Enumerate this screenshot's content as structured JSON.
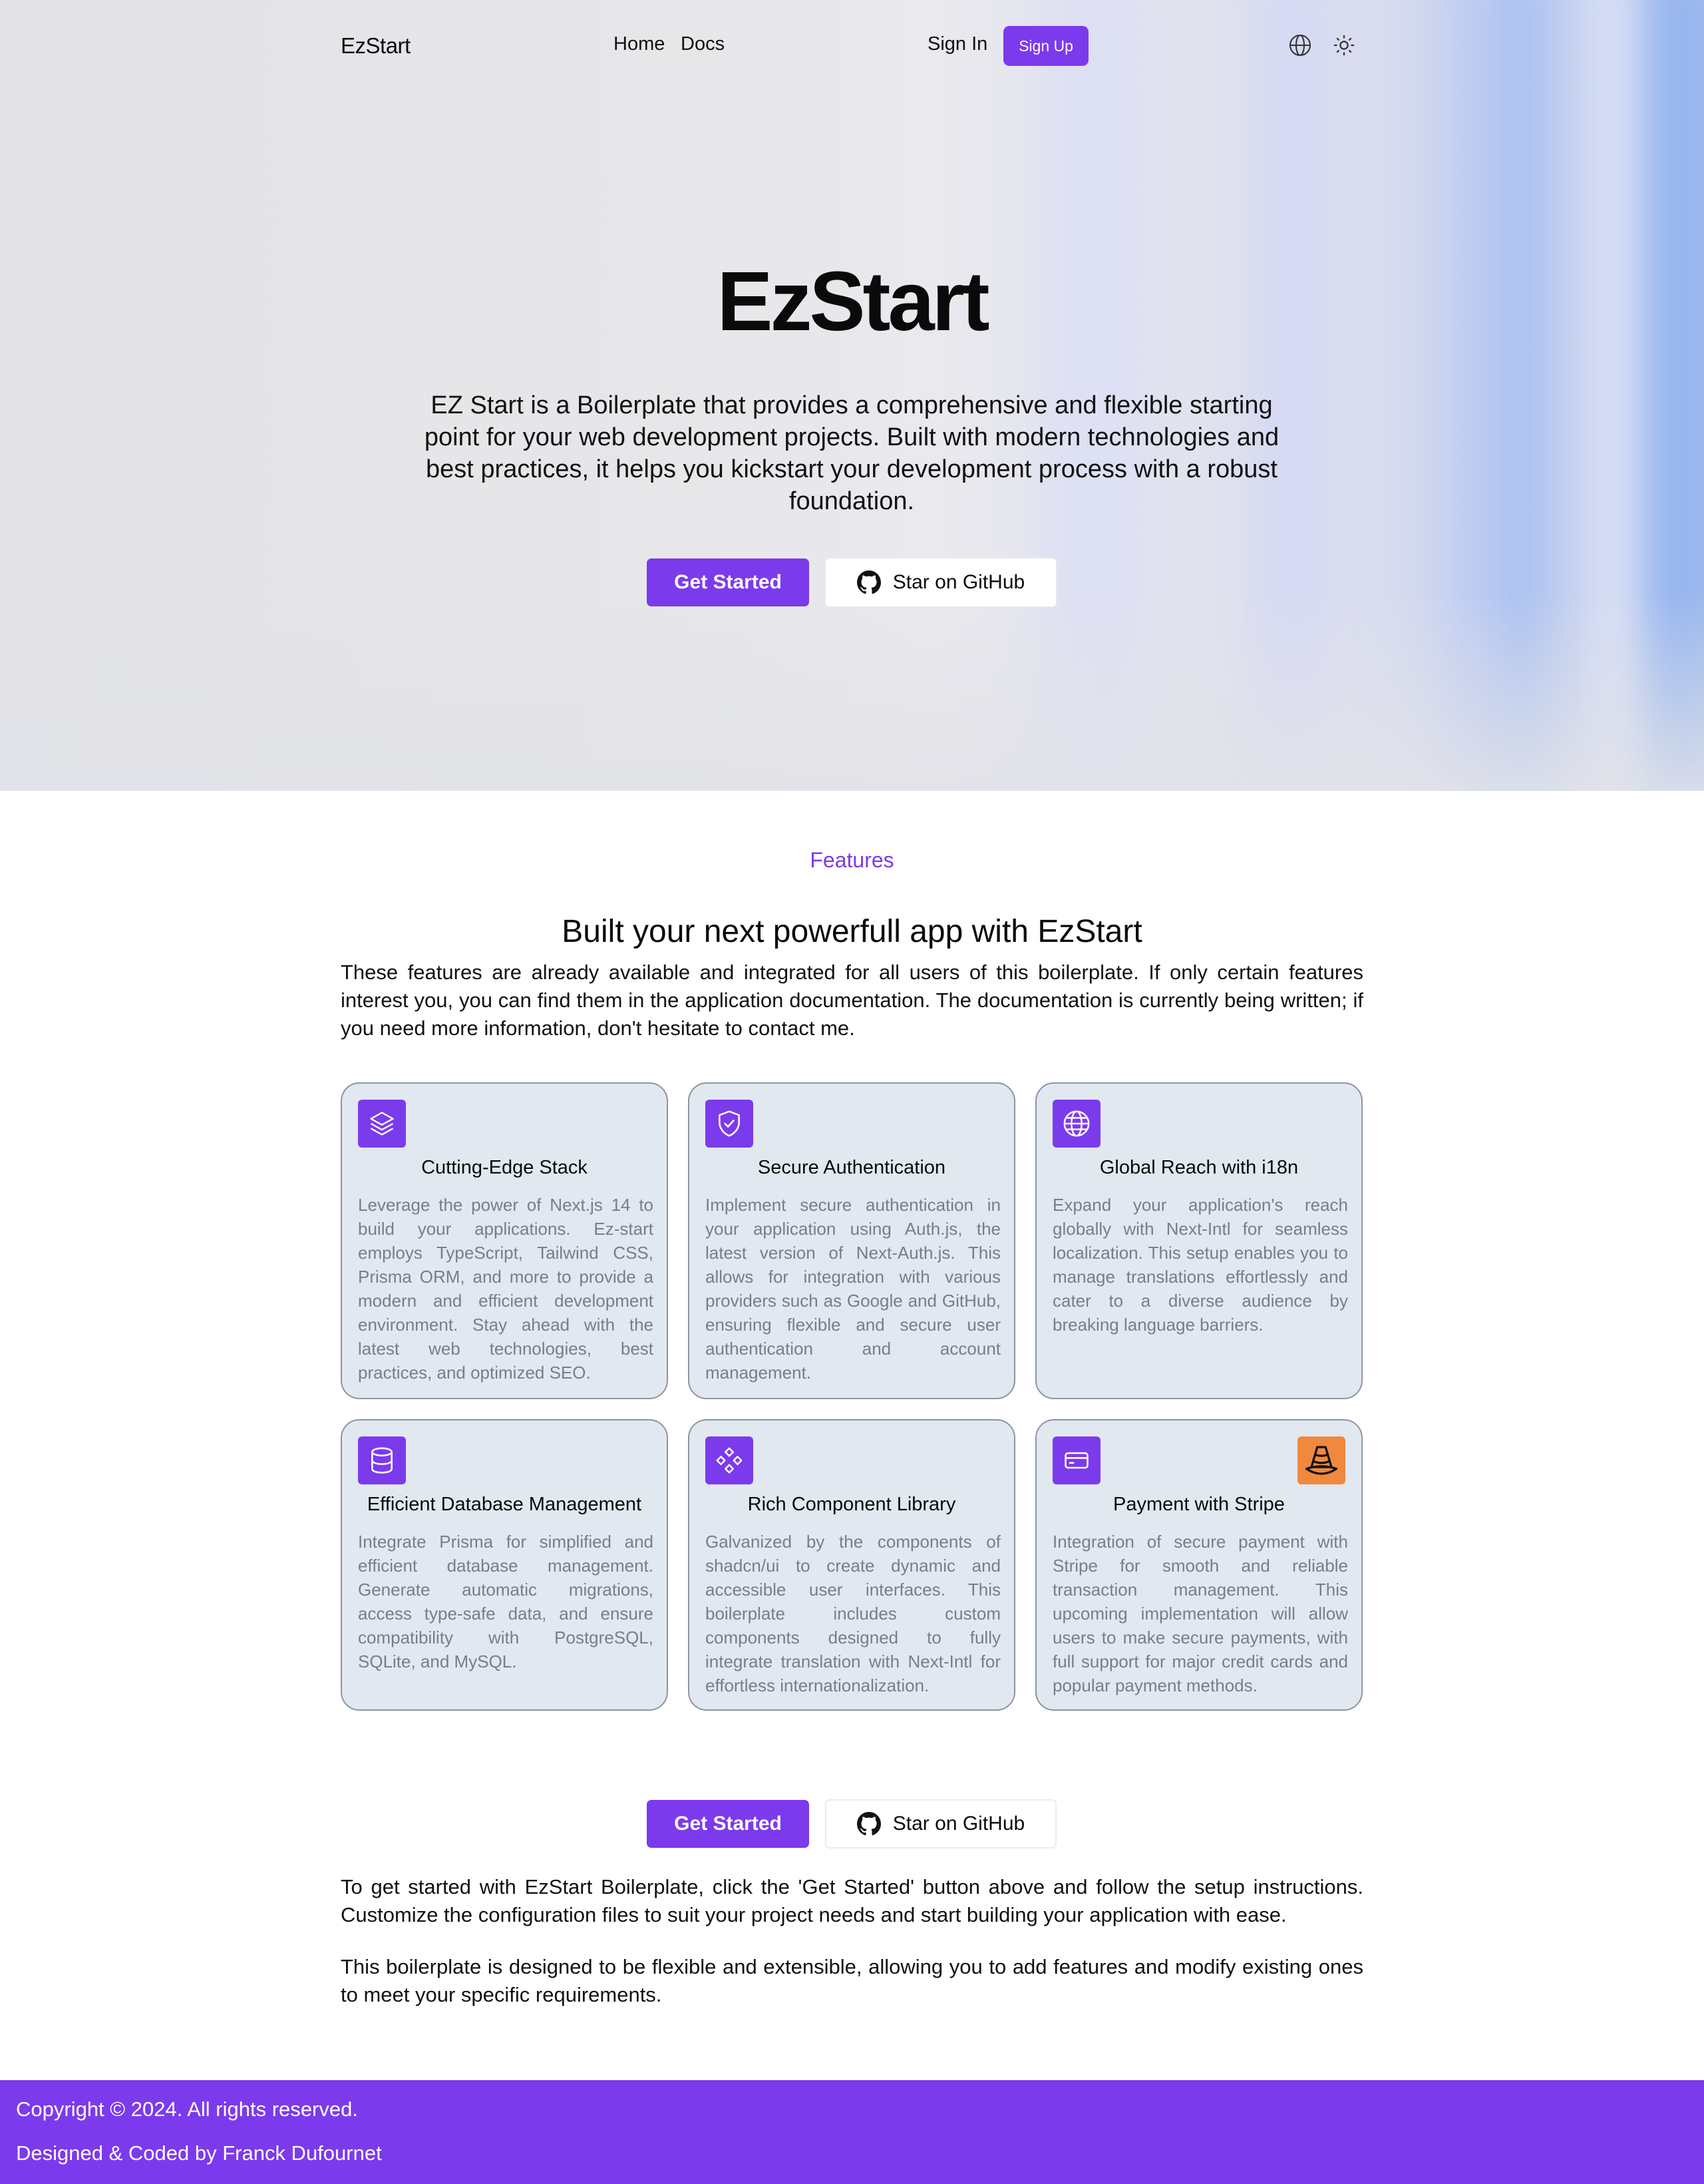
{
  "nav": {
    "brand": "EzStart",
    "links": [
      "Home",
      "Docs"
    ],
    "sign_in": "Sign In",
    "sign_up": "Sign Up",
    "icons": [
      "globe-icon",
      "sun-icon"
    ]
  },
  "hero": {
    "title": "EzStart",
    "description": "EZ Start is a Boilerplate that provides a comprehensive and flexible starting point for your web development projects. Built with modern technologies and best practices, it helps you kickstart your development process with a robust foundation.",
    "get_started": "Get Started",
    "star_github": "Star on GitHub"
  },
  "features": {
    "eyebrow": "Features",
    "title": "Built your next powerfull app with EzStart",
    "intro": "These features are already available and integrated for all users of this boilerplate. If only certain features interest you, you can find them in the application documentation. The documentation is currently being written; if you need more information, don't hesitate to contact me.",
    "cards": [
      {
        "icon": "layers-icon",
        "title": "Cutting-Edge Stack",
        "desc": "Leverage the power of Next.js 14 to build your applications. Ez-start employs TypeScript, Tailwind CSS, Prisma ORM, and more to provide a modern and efficient development environment. Stay ahead with the latest web technologies, best practices, and optimized SEO."
      },
      {
        "icon": "shield-check-icon",
        "title": "Secure Authentication",
        "desc": "Implement secure authentication in your application using Auth.js, the latest version of Next-Auth.js. This allows for integration with various providers such as Google and GitHub, ensuring flexible and secure user authentication and account management."
      },
      {
        "icon": "globe-icon",
        "title": "Global Reach with i18n",
        "desc": "Expand your application's reach globally with Next-Intl for seamless localization. This setup enables you to manage translations effortlessly and cater to a diverse audience by breaking language barriers."
      },
      {
        "icon": "database-icon",
        "title": "Efficient Database Management",
        "desc": "Integrate Prisma for simplified and efficient database management. Generate automatic migrations, access type-safe data, and ensure compatibility with PostgreSQL, SQLite, and MySQL."
      },
      {
        "icon": "component-icon",
        "title": "Rich Component Library",
        "desc": "Galvanized by the components of shadcn/ui to create dynamic and accessible user interfaces. This boilerplate includes custom components designed to fully integrate translation with Next-Intl for effortless internationalization."
      },
      {
        "icon": "credit-card-icon",
        "title": "Payment with Stripe",
        "desc": "Integration of secure payment with Stripe for smooth and reliable transaction management. This upcoming implementation will allow users to make secure payments, with full support for major credit cards and popular payment methods.",
        "badge_icon": "traffic-cone-icon"
      }
    ]
  },
  "cta": {
    "get_started": "Get Started",
    "star_github": "Star on GitHub",
    "paragraph1": "To get started with EzStart Boilerplate, click the 'Get Started' button above and follow the setup instructions. Customize the configuration files to suit your project needs and start building your application with ease.",
    "paragraph2": "This boilerplate is designed to be flexible and extensible, allowing you to add features and modify existing ones to meet your specific requirements."
  },
  "footer": {
    "copyright": "Copyright © 2024. All rights reserved.",
    "credit": "Designed & Coded by Franck Dufournet"
  },
  "colors": {
    "accent": "#7c3aed",
    "card_bg": "#e2e8f0",
    "card_border": "#8d94a3",
    "muted_text": "#777e8b",
    "cone_orange": "#f0883e"
  }
}
